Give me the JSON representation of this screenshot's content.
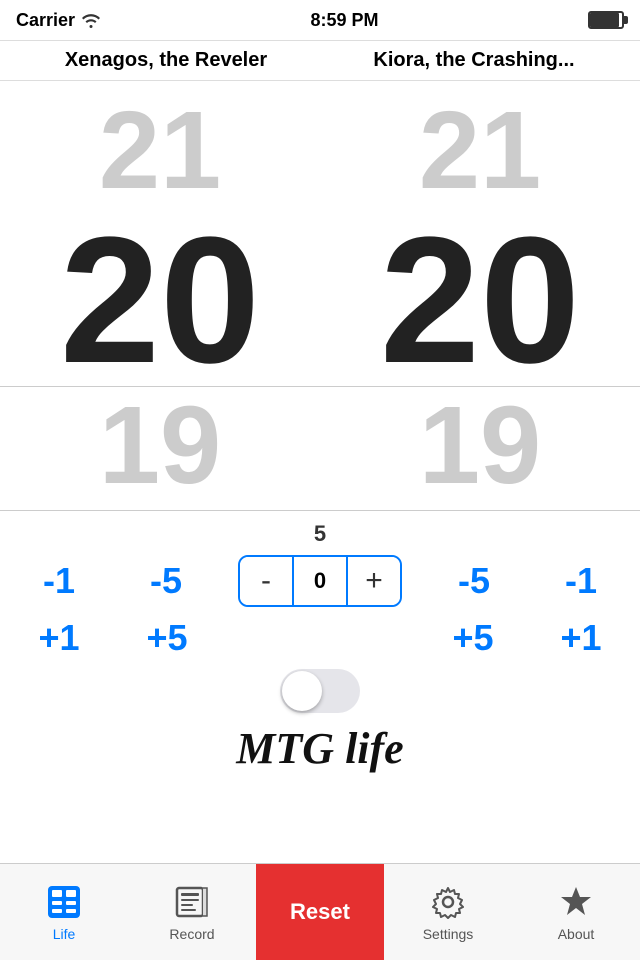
{
  "status": {
    "carrier": "Carrier",
    "time": "8:59 PM"
  },
  "players": [
    {
      "name": "Xenagos, the Reveler",
      "current": 20,
      "prev": 21,
      "next": 19
    },
    {
      "name": "Kiora, the Crashing...",
      "current": 20,
      "prev": 21,
      "next": 19
    }
  ],
  "controls": {
    "delta": 5,
    "stepper_value": 0,
    "minus1_label": "-1",
    "minus5_label": "-5",
    "plus1_label": "+1",
    "plus5_label": "+5",
    "stepper_minus": "-",
    "stepper_plus": "+"
  },
  "app": {
    "title": "MTG life"
  },
  "tabs": [
    {
      "id": "life",
      "label": "Life",
      "active": true
    },
    {
      "id": "record",
      "label": "Record",
      "active": false
    },
    {
      "id": "reset",
      "label": "Reset",
      "active": false,
      "special": "reset"
    },
    {
      "id": "settings",
      "label": "Settings",
      "active": false
    },
    {
      "id": "about",
      "label": "About",
      "active": false
    }
  ]
}
